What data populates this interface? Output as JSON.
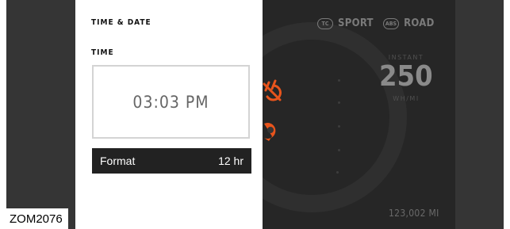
{
  "panel": {
    "title": "TIME & DATE",
    "section_label": "TIME",
    "time_value": "03:03 PM",
    "format_label": "Format",
    "format_value": "12 hr"
  },
  "cluster": {
    "modes": [
      {
        "badge": "TC",
        "label": "SPORT"
      },
      {
        "badge": "ABS",
        "label": "ROAD"
      }
    ],
    "instant_label": "INSTANT",
    "instant_value": "250",
    "instant_unit": "WH/MI",
    "odometer": "123,002 MI",
    "icons": [
      "traction-control-off-icon",
      "tire-pressure-warning-icon"
    ],
    "warning_color": "#e8541c"
  },
  "caption": "ZOM2076"
}
